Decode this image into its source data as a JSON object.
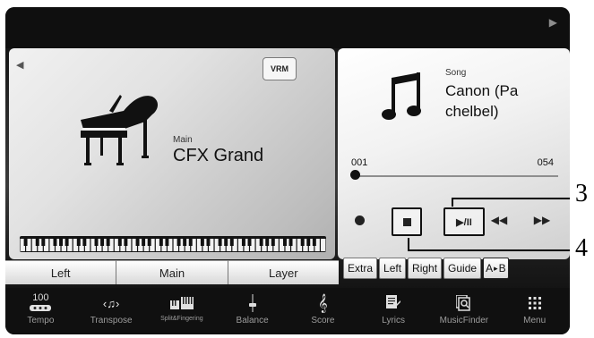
{
  "voice": {
    "category": "Main",
    "name": "CFX Grand",
    "vrm_label": "VRM"
  },
  "parts": [
    "Left",
    "Main",
    "Layer"
  ],
  "song": {
    "label": "Song",
    "title": "Canon (Pa chelbel)",
    "measure_start": "001",
    "measure_end": "054",
    "position_fraction": 0.02,
    "play_label": "▶/II"
  },
  "song_parts": [
    "Extra",
    "Left",
    "Right",
    "Guide"
  ],
  "ab_label": {
    "a": "A",
    "b": "B"
  },
  "bottom_bar": {
    "tempo_value": "100",
    "items": [
      "Tempo",
      "Transpose",
      "Split&Fingering",
      "Balance",
      "Score",
      "Lyrics",
      "MusicFinder",
      "Menu"
    ]
  },
  "callouts": [
    "3",
    "4"
  ],
  "icons": [
    "piano-icon",
    "music-note-icon",
    "record-icon",
    "stop-icon",
    "play-pause-icon",
    "rewind-icon",
    "fast-forward-icon",
    "tempo-icon",
    "transpose-icon",
    "split-fingering-icon",
    "balance-icon",
    "treble-clef-icon",
    "lyrics-icon",
    "music-finder-icon",
    "menu-grid-icon"
  ]
}
